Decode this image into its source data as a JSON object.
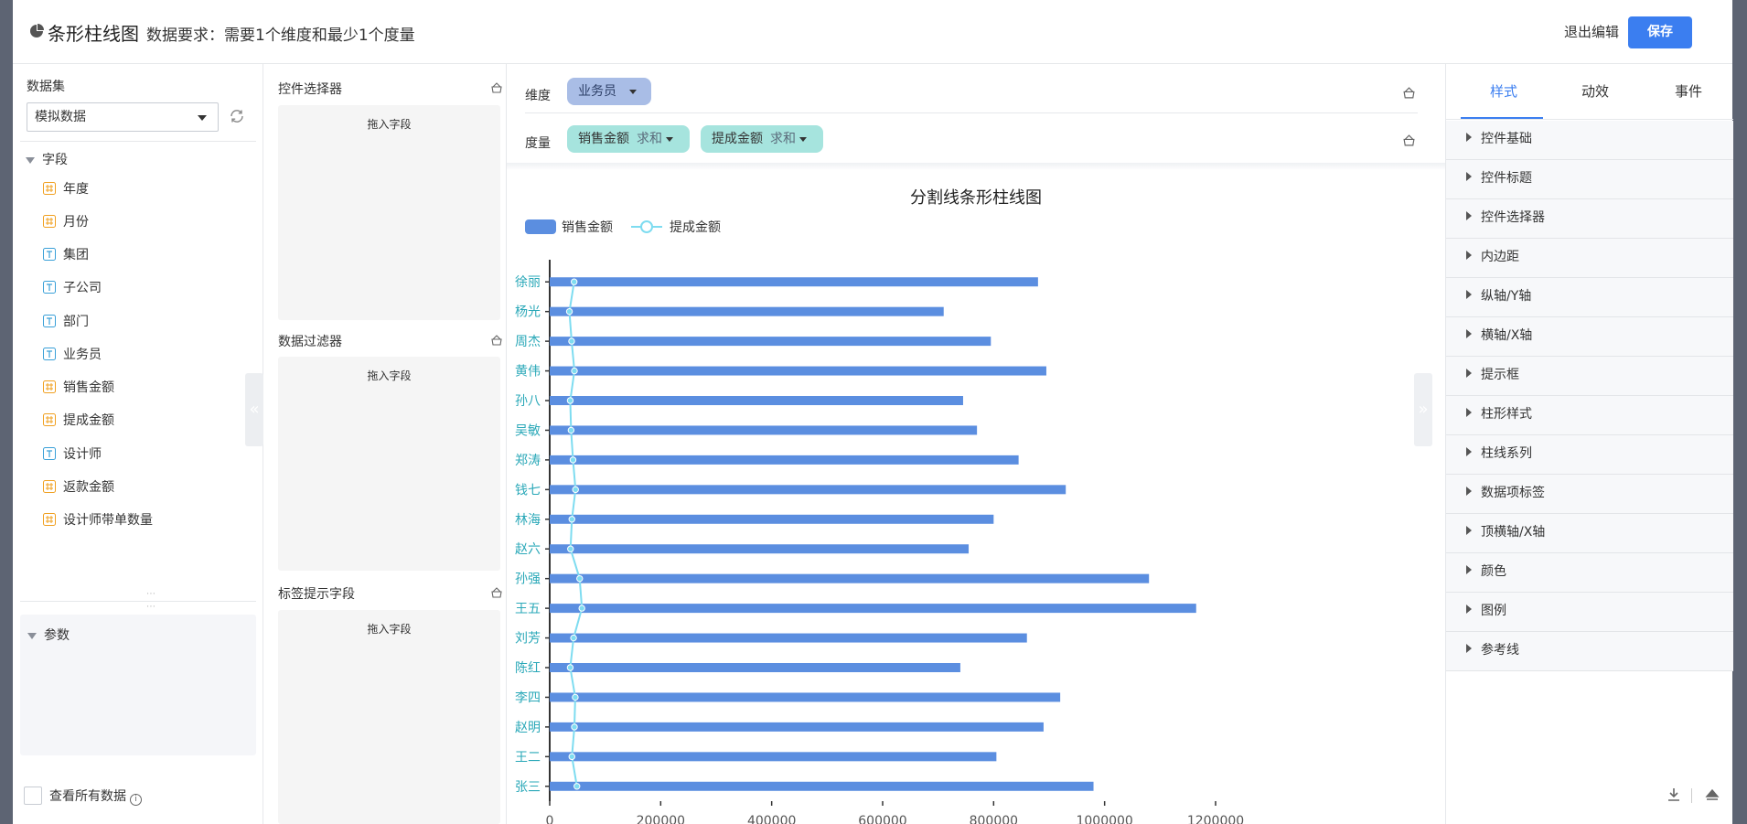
{
  "header": {
    "title": "条形柱线图",
    "requirement": "数据要求：需要1个维度和最少1个度量",
    "exit_label": "退出编辑",
    "save_label": "保存"
  },
  "left": {
    "dataset_label": "数据集",
    "dataset_value": "模拟数据",
    "fields_label": "字段",
    "fields": [
      {
        "icon": "number-icon",
        "label": "年度"
      },
      {
        "icon": "number-icon",
        "label": "月份"
      },
      {
        "icon": "text-icon",
        "label": "集团"
      },
      {
        "icon": "text-icon",
        "label": "子公司"
      },
      {
        "icon": "text-icon",
        "label": "部门"
      },
      {
        "icon": "text-icon",
        "label": "业务员"
      },
      {
        "icon": "number-icon",
        "label": "销售金额"
      },
      {
        "icon": "number-icon",
        "label": "提成金额"
      },
      {
        "icon": "text-icon",
        "label": "设计师"
      },
      {
        "icon": "number-icon",
        "label": "返款金额"
      },
      {
        "icon": "number-icon",
        "label": "设计师带单数量"
      }
    ],
    "params_label": "参数",
    "view_all_label": "查看所有数据"
  },
  "middle": {
    "sections": [
      {
        "label": "控件选择器",
        "drop_text": "拖入字段"
      },
      {
        "label": "数据过滤器",
        "drop_text": "拖入字段"
      },
      {
        "label": "标签提示字段",
        "drop_text": "拖入字段"
      }
    ]
  },
  "config": {
    "dimension_label": "维度",
    "dimension_pill": "业务员",
    "measure_label": "度量",
    "measures": [
      {
        "name": "销售金额",
        "agg": "求和"
      },
      {
        "name": "提成金额",
        "agg": "求和"
      }
    ]
  },
  "chart_data": {
    "type": "bar",
    "orientation": "horizontal",
    "title": "分割线条形柱线图",
    "categories": [
      "张三",
      "王二",
      "赵明",
      "李四",
      "陈红",
      "刘芳",
      "王五",
      "孙强",
      "赵六",
      "林海",
      "钱七",
      "郑涛",
      "吴敏",
      "孙八",
      "黄伟",
      "周杰",
      "杨光",
      "徐丽"
    ],
    "series": [
      {
        "name": "销售金额",
        "type": "bar",
        "color": "#5b8ee0",
        "values": [
          980000,
          805000,
          890000,
          920000,
          740000,
          860000,
          1165000,
          1080000,
          755000,
          800000,
          930000,
          845000,
          770000,
          745000,
          895000,
          795000,
          710000,
          880000
        ]
      },
      {
        "name": "提成金额",
        "type": "line",
        "color": "#7edcf0",
        "values": [
          49000,
          40000,
          44500,
          46000,
          37000,
          43000,
          58000,
          54000,
          37500,
          40000,
          46500,
          42000,
          38500,
          37000,
          44500,
          39500,
          35500,
          44000
        ]
      }
    ],
    "x_ticks": [
      "0",
      "200000",
      "400000",
      "600000",
      "800000",
      "1000000",
      "1200000"
    ],
    "xlim": [
      0,
      1200000
    ],
    "legend": "top-left",
    "grid": false
  },
  "right": {
    "tabs": [
      "样式",
      "动效",
      "事件"
    ],
    "active_tab": "样式",
    "sections": [
      "控件基础",
      "控件标题",
      "控件选择器",
      "内边距",
      "纵轴/Y轴",
      "横轴/X轴",
      "提示框",
      "柱形样式",
      "柱线系列",
      "数据项标签",
      "顶横轴/X轴",
      "颜色",
      "图例",
      "参考线"
    ]
  }
}
